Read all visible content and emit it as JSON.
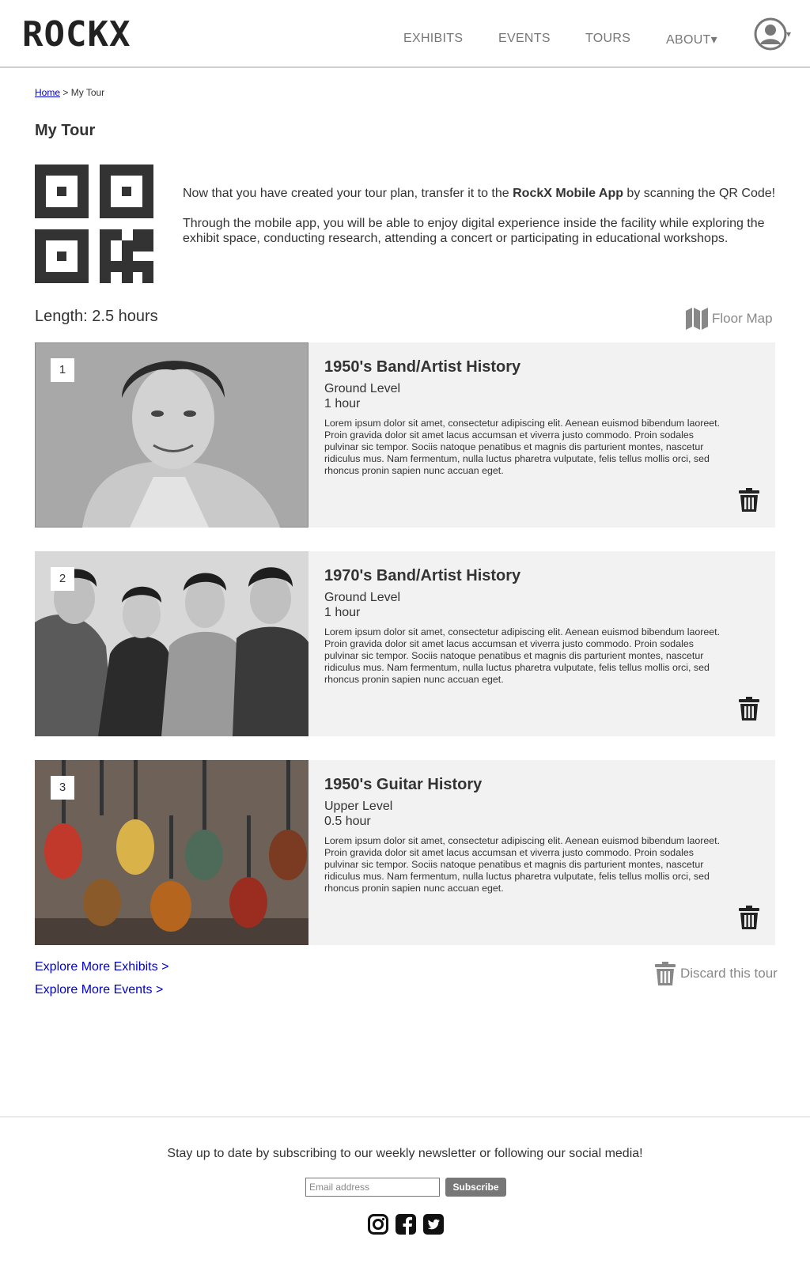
{
  "header": {
    "logo": "ROCKX",
    "nav": {
      "exhibits": "EXHIBITS",
      "events": "EVENTS",
      "tours": "TOURS",
      "about": "ABOUT▾"
    },
    "avatar_caret": "▾"
  },
  "breadcrumb": {
    "home": "Home",
    "separator": " > ",
    "current": "My Tour"
  },
  "page_title": "My Tour",
  "intro": {
    "line1_pre": "Now that you have created your tour plan, transfer it to the ",
    "line1_bold": "RockX Mobile App",
    "line1_post": " by scanning the QR Code!",
    "line2": "Through the mobile app, you will be able to enjoy digital experience inside the facility while exploring the exhibit space, conducting research, attending a concert or participating in educational workshops."
  },
  "length": "Length: 2.5 hours",
  "floor_map": "Floor Map",
  "tours": [
    {
      "number": "1",
      "title": "1950's Band/Artist History",
      "level": "Ground Level",
      "duration": "1 hour",
      "description": "Lorem ipsum dolor sit amet, consectetur adipiscing elit. Aenean euismod bibendum laoreet. Proin gravida dolor sit amet lacus accumsan et viverra justo commodo. Proin sodales pulvinar sic tempor. Sociis natoque penatibus et magnis dis parturient montes, nascetur ridiculus mus. Nam fermentum, nulla luctus pharetra vulputate, felis tellus mollis orci, sed rhoncus pronin sapien nunc accuan eget."
    },
    {
      "number": "2",
      "title": "1970's Band/Artist History",
      "level": "Ground Level",
      "duration": "1 hour",
      "description": "Lorem ipsum dolor sit amet, consectetur adipiscing elit. Aenean euismod bibendum laoreet. Proin gravida dolor sit amet lacus accumsan et viverra justo commodo. Proin sodales pulvinar sic tempor. Sociis natoque penatibus et magnis dis parturient montes, nascetur ridiculus mus. Nam fermentum, nulla luctus pharetra vulputate, felis tellus mollis orci, sed rhoncus pronin sapien nunc accuan eget."
    },
    {
      "number": "3",
      "title": "1950's Guitar History",
      "level": "Upper Level",
      "duration": "0.5 hour",
      "description": "Lorem ipsum dolor sit amet, consectetur adipiscing elit. Aenean euismod bibendum laoreet. Proin gravida dolor sit amet lacus accumsan et viverra justo commodo. Proin sodales pulvinar sic tempor. Sociis natoque penatibus et magnis dis parturient montes, nascetur ridiculus mus. Nam fermentum, nulla luctus pharetra vulputate, felis tellus mollis orci, sed rhoncus pronin sapien nunc accuan eget."
    }
  ],
  "links": {
    "explore_exhibits": "Explore More Exhibits >",
    "explore_events": "Explore More Events >"
  },
  "discard": "Discard this tour",
  "footer": {
    "text": "Stay up to date by subscribing to our weekly newsletter or following our social media!",
    "email_placeholder": "Email address",
    "subscribe": "Subscribe",
    "social_icons": [
      "instagram-icon",
      "facebook-icon",
      "twitter-icon"
    ]
  },
  "colors": {
    "link": "#0000cc",
    "card_bg": "#f2f2f2",
    "nav_text": "#777777",
    "button_bg": "#777777"
  }
}
